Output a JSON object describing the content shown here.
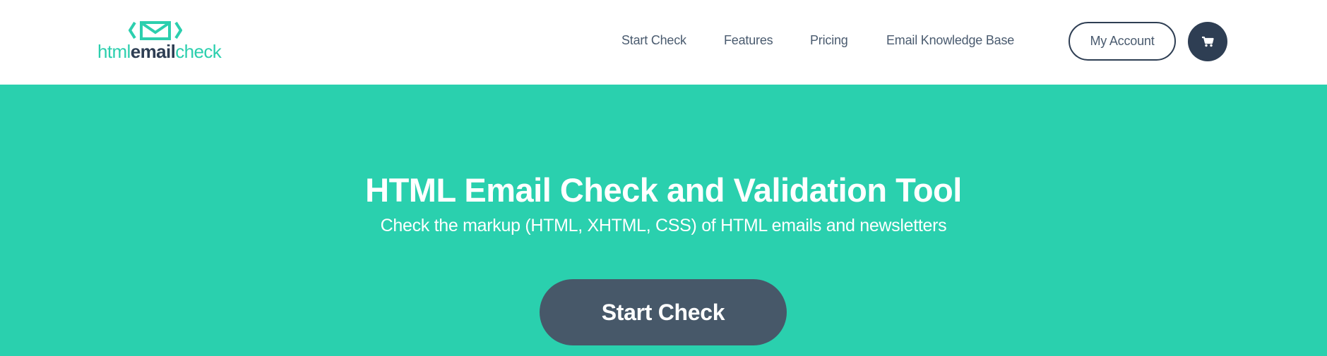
{
  "header": {
    "logo": {
      "part1": "html",
      "part2": "email",
      "part3": "check",
      "icon": "envelope-brackets-icon"
    },
    "nav": [
      {
        "label": "Start Check"
      },
      {
        "label": "Features"
      },
      {
        "label": "Pricing"
      },
      {
        "label": "Email Knowledge Base"
      }
    ],
    "account_label": "My Account",
    "cart_icon": "shopping-cart-icon"
  },
  "hero": {
    "title": "HTML Email Check and Validation Tool",
    "subtitle": "Check the markup (HTML, XHTML, CSS) of HTML emails and newsletters",
    "cta_label": "Start Check"
  },
  "colors": {
    "brand_teal": "#2ad0ae",
    "dark_navy": "#2e3e53",
    "button_slate": "#475869",
    "nav_text": "#4a5b6f"
  }
}
